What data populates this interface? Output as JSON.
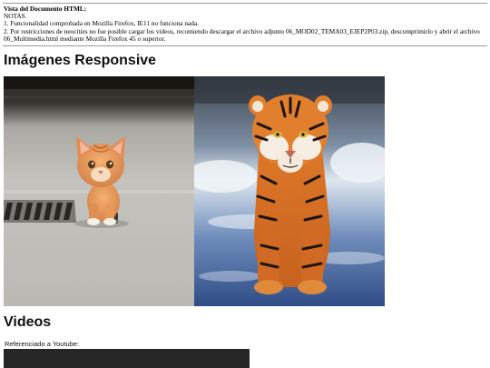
{
  "notes": {
    "title": "Vista del Documento HTML:",
    "heading": "NOTAS.",
    "line1": "1. Funcionalidad comprobada en Mozilla Firefox, IE11 no funciona nada.",
    "line2": "2. Por restricciones de neocities no fue posible cargar los videos, recomiendo descargar el archivo adjunto 06_MOD02_TEMA03_EJEP2P03.zip, descomprimirlo y abrir el archivo",
    "line3": "06_Multimedia.html mediante Mozilla Firefox 45 o superior."
  },
  "images_section": {
    "title": "Imágenes Responsive",
    "photos": [
      {
        "subject": "kitten-photo"
      },
      {
        "subject": "tiger-photo"
      }
    ]
  },
  "videos_section": {
    "title": "Videos",
    "youtube_label": "Referenciado a Youtube:"
  }
}
